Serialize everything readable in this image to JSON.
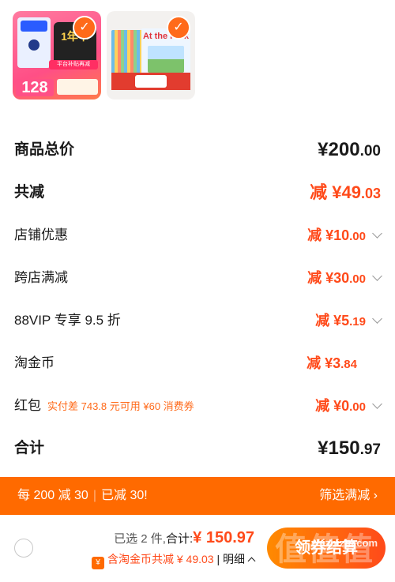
{
  "items": [
    {
      "thumb_texts": [
        "1年卡",
        "平台补贴再减",
        "128"
      ],
      "checked": true
    },
    {
      "thumb_texts": [
        "At the Park"
      ],
      "checked": true
    }
  ],
  "summary": {
    "total_label": "商品总价",
    "total_yen": "¥",
    "total_int": "200",
    "total_dec": ".00",
    "reduce_label": "共减",
    "reduce_prefix": "减 ¥",
    "reduce_int": "49",
    "reduce_dec": ".03",
    "rows": [
      {
        "label": "店铺优惠",
        "prefix": "减 ¥",
        "int": "10",
        "dec": ".00",
        "has_chevron": true
      },
      {
        "label": "跨店满减",
        "prefix": "减 ¥",
        "int": "30",
        "dec": ".00",
        "has_chevron": true
      },
      {
        "label": "88VIP 专享 9.5 折",
        "prefix": "减 ¥",
        "int": "5",
        "dec": ".19",
        "has_chevron": true
      },
      {
        "label": "淘金币",
        "prefix": "减 ¥",
        "int": "3",
        "dec": ".84",
        "has_chevron": false
      },
      {
        "label": "红包",
        "note": "实付差 743.8 元可用 ¥60 消费券",
        "prefix": "减 ¥",
        "int": "0",
        "dec": ".00",
        "has_chevron": true
      }
    ],
    "sum_label": "合计",
    "sum_yen": "¥",
    "sum_int": "150",
    "sum_dec": ".97"
  },
  "promo_bar": {
    "left_a": "每 200 减 30",
    "sep": "|",
    "left_b": "已减 30!",
    "right": "筛选满减 ›"
  },
  "footer": {
    "selected_text": "已选 2 件,",
    "total_label": "合计:",
    "total_value": "¥ 150.97",
    "coin_icon": "¥",
    "coin_text": "含淘金币共减 ¥ 49.03",
    "detail_sep": "|",
    "detail": "明细",
    "settle_label": "领券结算",
    "watermark_big": "值值值",
    "watermark": "zhizhizhi.com"
  },
  "colors": {
    "accent": "#ff6a00",
    "discount": "#ff4a1a"
  }
}
